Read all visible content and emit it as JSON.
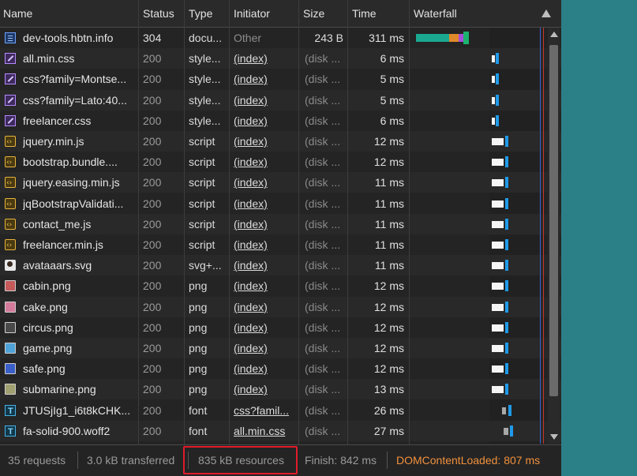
{
  "columns": {
    "name": "Name",
    "status": "Status",
    "type": "Type",
    "initiator": "Initiator",
    "size": "Size",
    "time": "Time",
    "waterfall": "Waterfall"
  },
  "requests": [
    {
      "name": "dev-tools.hbtn.info",
      "status": "304",
      "type": "docu...",
      "initiator": "Other",
      "size": "243 B",
      "time": "311 ms",
      "icon": "document-icon"
    },
    {
      "name": "all.min.css",
      "status": "200",
      "type": "style...",
      "initiator": "(index)",
      "size": "(disk ...",
      "time": "6 ms",
      "icon": "stylesheet-icon"
    },
    {
      "name": "css?family=Montse...",
      "status": "200",
      "type": "style...",
      "initiator": "(index)",
      "size": "(disk ...",
      "time": "5 ms",
      "icon": "stylesheet-icon"
    },
    {
      "name": "css?family=Lato:40...",
      "status": "200",
      "type": "style...",
      "initiator": "(index)",
      "size": "(disk ...",
      "time": "5 ms",
      "icon": "stylesheet-icon"
    },
    {
      "name": "freelancer.css",
      "status": "200",
      "type": "style...",
      "initiator": "(index)",
      "size": "(disk ...",
      "time": "6 ms",
      "icon": "stylesheet-icon"
    },
    {
      "name": "jquery.min.js",
      "status": "200",
      "type": "script",
      "initiator": "(index)",
      "size": "(disk ...",
      "time": "12 ms",
      "icon": "script-icon"
    },
    {
      "name": "bootstrap.bundle....",
      "status": "200",
      "type": "script",
      "initiator": "(index)",
      "size": "(disk ...",
      "time": "12 ms",
      "icon": "script-icon"
    },
    {
      "name": "jquery.easing.min.js",
      "status": "200",
      "type": "script",
      "initiator": "(index)",
      "size": "(disk ...",
      "time": "11 ms",
      "icon": "script-icon"
    },
    {
      "name": "jqBootstrapValidati...",
      "status": "200",
      "type": "script",
      "initiator": "(index)",
      "size": "(disk ...",
      "time": "11 ms",
      "icon": "script-icon"
    },
    {
      "name": "contact_me.js",
      "status": "200",
      "type": "script",
      "initiator": "(index)",
      "size": "(disk ...",
      "time": "11 ms",
      "icon": "script-icon"
    },
    {
      "name": "freelancer.min.js",
      "status": "200",
      "type": "script",
      "initiator": "(index)",
      "size": "(disk ...",
      "time": "11 ms",
      "icon": "script-icon"
    },
    {
      "name": "avataaars.svg",
      "status": "200",
      "type": "svg+...",
      "initiator": "(index)",
      "size": "(disk ...",
      "time": "11 ms",
      "icon": "svg-image-icon"
    },
    {
      "name": "cabin.png",
      "status": "200",
      "type": "png",
      "initiator": "(index)",
      "size": "(disk ...",
      "time": "12 ms",
      "icon": "image-icon"
    },
    {
      "name": "cake.png",
      "status": "200",
      "type": "png",
      "initiator": "(index)",
      "size": "(disk ...",
      "time": "12 ms",
      "icon": "image-icon"
    },
    {
      "name": "circus.png",
      "status": "200",
      "type": "png",
      "initiator": "(index)",
      "size": "(disk ...",
      "time": "12 ms",
      "icon": "image-icon"
    },
    {
      "name": "game.png",
      "status": "200",
      "type": "png",
      "initiator": "(index)",
      "size": "(disk ...",
      "time": "12 ms",
      "icon": "image-icon"
    },
    {
      "name": "safe.png",
      "status": "200",
      "type": "png",
      "initiator": "(index)",
      "size": "(disk ...",
      "time": "12 ms",
      "icon": "image-icon"
    },
    {
      "name": "submarine.png",
      "status": "200",
      "type": "png",
      "initiator": "(index)",
      "size": "(disk ...",
      "time": "13 ms",
      "icon": "image-icon"
    },
    {
      "name": "JTUSjIg1_i6t8kCHK...",
      "status": "200",
      "type": "font",
      "initiator": "css?famil...",
      "size": "(disk ...",
      "time": "26 ms",
      "icon": "font-icon"
    },
    {
      "name": "fa-solid-900.woff2",
      "status": "200",
      "type": "font",
      "initiator": "all.min.css",
      "size": "(disk ...",
      "time": "27 ms",
      "icon": "font-icon"
    }
  ],
  "status_bar": {
    "requests": "35 requests",
    "transferred": "3.0 kB transferred",
    "resources": "835 kB resources",
    "finish": "Finish: 842 ms",
    "dom_content_loaded": "DOMContentLoaded: 807 ms"
  },
  "colors": {
    "dom_content_loaded": "#f2913d",
    "highlight": "#e11b2a",
    "waterfall_blue": "#1f9ae8"
  }
}
